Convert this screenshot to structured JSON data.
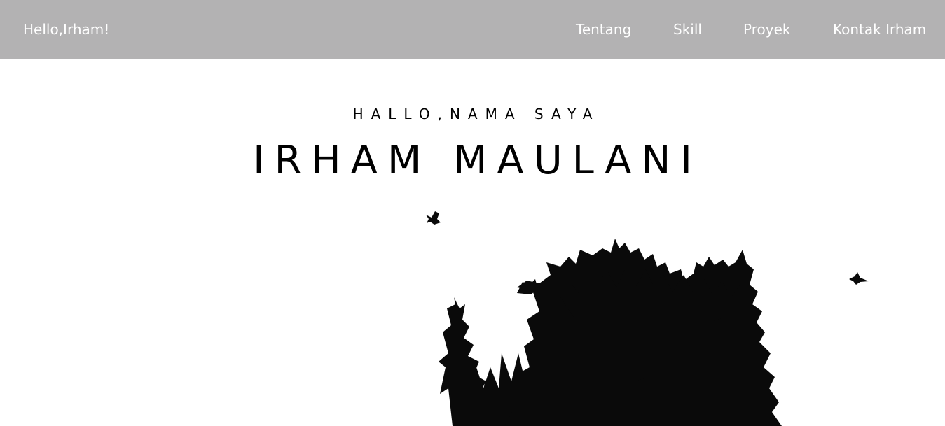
{
  "nav": {
    "brand": "Hello,Irham!",
    "links": [
      "Tentang",
      "Skill",
      "Proyek",
      "Kontak Irham"
    ]
  },
  "hero": {
    "greeting": "HALLO,NAMA SAYA",
    "name": "IRHAM MAULANI"
  },
  "colors": {
    "navbar_bg": "#b3b2b3",
    "nav_text": "#ffffff",
    "hero_text": "#000000",
    "silhouette": "#0a0a0a"
  },
  "icons": [
    "bird-icon",
    "bird-icon",
    "tree-silhouette"
  ]
}
